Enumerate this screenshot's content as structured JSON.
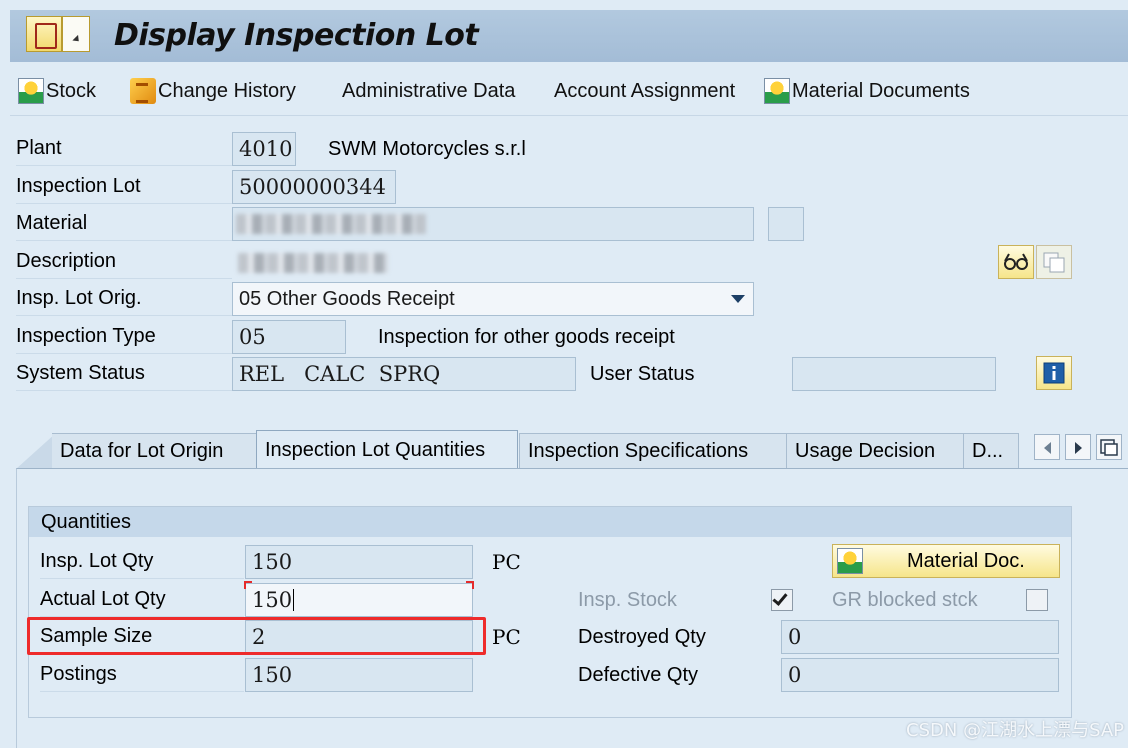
{
  "window": {
    "title": "Display Inspection Lot"
  },
  "toolbar": {
    "stock": "Stock",
    "change_history": "Change History",
    "administrative_data": "Administrative Data",
    "account_assignment": "Account Assignment",
    "material_documents": "Material Documents"
  },
  "header": {
    "plant_label": "Plant",
    "plant_value": "4010",
    "plant_name": "SWM Motorcycles s.r.l",
    "inspection_lot_label": "Inspection Lot",
    "inspection_lot_value": "50000000344",
    "material_label": "Material",
    "description_label": "Description",
    "insp_lot_orig_label": "Insp. Lot Orig.",
    "insp_lot_orig_value": "05 Other Goods Receipt",
    "inspection_type_label": "Inspection Type",
    "inspection_type_value": "05",
    "inspection_type_text": "Inspection for other goods receipt",
    "system_status_label": "System Status",
    "system_status_value": "REL   CALC  SPRQ",
    "user_status_label": "User Status",
    "user_status_value": ""
  },
  "tabs": [
    {
      "label": "Data for Lot Origin",
      "active": false
    },
    {
      "label": "Inspection Lot Quantities",
      "active": true
    },
    {
      "label": "Inspection Specifications",
      "active": false
    },
    {
      "label": "Usage Decision",
      "active": false
    },
    {
      "label": "D...",
      "active": false
    }
  ],
  "quantities": {
    "group_title": "Quantities",
    "insp_lot_qty_label": "Insp. Lot Qty",
    "insp_lot_qty_value": "150",
    "insp_lot_qty_unit": "PC",
    "actual_lot_qty_label": "Actual Lot Qty",
    "actual_lot_qty_value": "150",
    "sample_size_label": "Sample Size",
    "sample_size_value": "2",
    "sample_size_unit": "PC",
    "postings_label": "Postings",
    "postings_value": "150",
    "material_doc_button": "Material Doc.",
    "insp_stock_label": "Insp. Stock",
    "insp_stock_checked": true,
    "gr_blocked_label": "GR blocked stck",
    "gr_blocked_checked": false,
    "destroyed_qty_label": "Destroyed Qty",
    "destroyed_qty_value": "0",
    "defective_qty_label": "Defective Qty",
    "defective_qty_value": "0"
  },
  "watermark": "CSDN @江湖水上漂与SAP",
  "colors": {
    "highlight": "#ee2b2b",
    "title_bar": "#a9c1d9",
    "background": "#dfebf5"
  }
}
